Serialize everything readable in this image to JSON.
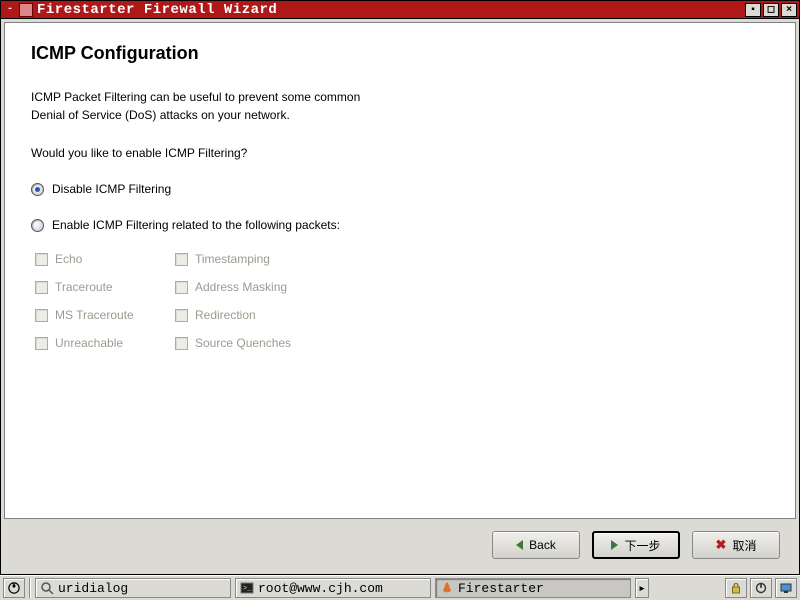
{
  "window": {
    "title": "Firestarter Firewall Wizard"
  },
  "wizard": {
    "heading": "ICMP Configuration",
    "desc1": "ICMP Packet Filtering can be useful to prevent some common",
    "desc2": "Denial of Service (DoS) attacks on your network.",
    "prompt": "Would you like to enable ICMP Filtering?",
    "radio_disable": "Disable ICMP Filtering",
    "radio_enable": "Enable ICMP Filtering related to the following packets:",
    "packets": {
      "echo": "Echo",
      "traceroute": "Traceroute",
      "mstraceroute": "MS Traceroute",
      "unreachable": "Unreachable",
      "timestamping": "Timestamping",
      "addressmasking": "Address Masking",
      "redirection": "Redirection",
      "sourcequenches": "Source Quenches"
    }
  },
  "buttons": {
    "back": "Back",
    "next": "下一步",
    "cancel": "取消"
  },
  "taskbar": {
    "task1": "uridialog",
    "task2": "root@www.cjh.com",
    "task3": "Firestarter"
  }
}
